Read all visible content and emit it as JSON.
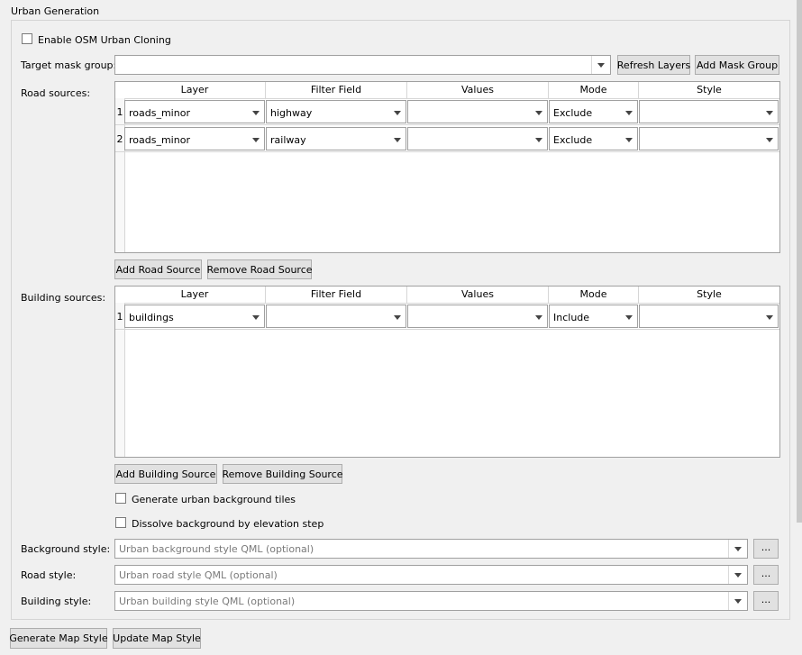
{
  "group": {
    "title": "Urban Generation"
  },
  "enable_osm": {
    "label": "Enable OSM Urban Cloning",
    "checked": false
  },
  "target_mask": {
    "label": "Target mask group:",
    "value": "",
    "refresh_label": "Refresh Layers",
    "add_mask_label": "Add Mask Group"
  },
  "columns": [
    "Layer",
    "Filter Field",
    "Values",
    "Mode",
    "Style"
  ],
  "road_sources": {
    "label": "Road sources:",
    "rows": [
      {
        "num": "1",
        "layer": "roads_minor",
        "filter": "highway",
        "values": "",
        "mode": "Exclude",
        "style": ""
      },
      {
        "num": "2",
        "layer": "roads_minor",
        "filter": "railway",
        "values": "",
        "mode": "Exclude",
        "style": ""
      }
    ],
    "add_label": "Add Road Source",
    "remove_label": "Remove Road Source"
  },
  "building_sources": {
    "label": "Building sources:",
    "rows": [
      {
        "num": "1",
        "layer": "buildings",
        "filter": "",
        "values": "",
        "mode": "Include",
        "style": ""
      }
    ],
    "add_label": "Add Building Source",
    "remove_label": "Remove Building Source"
  },
  "options": {
    "background_tiles": {
      "label": "Generate urban background tiles",
      "checked": false
    },
    "dissolve": {
      "label": "Dissolve background by elevation step",
      "checked": false
    }
  },
  "styles": {
    "background": {
      "label": "Background style:",
      "placeholder": "Urban background style QML (optional)",
      "browse": "..."
    },
    "road": {
      "label": "Road style:",
      "placeholder": "Urban road style QML (optional)",
      "browse": "..."
    },
    "building": {
      "label": "Building style:",
      "placeholder": "Urban building style QML (optional)",
      "browse": "..."
    }
  },
  "footer": {
    "generate_label": "Generate Map Style",
    "update_label": "Update Map Style"
  }
}
